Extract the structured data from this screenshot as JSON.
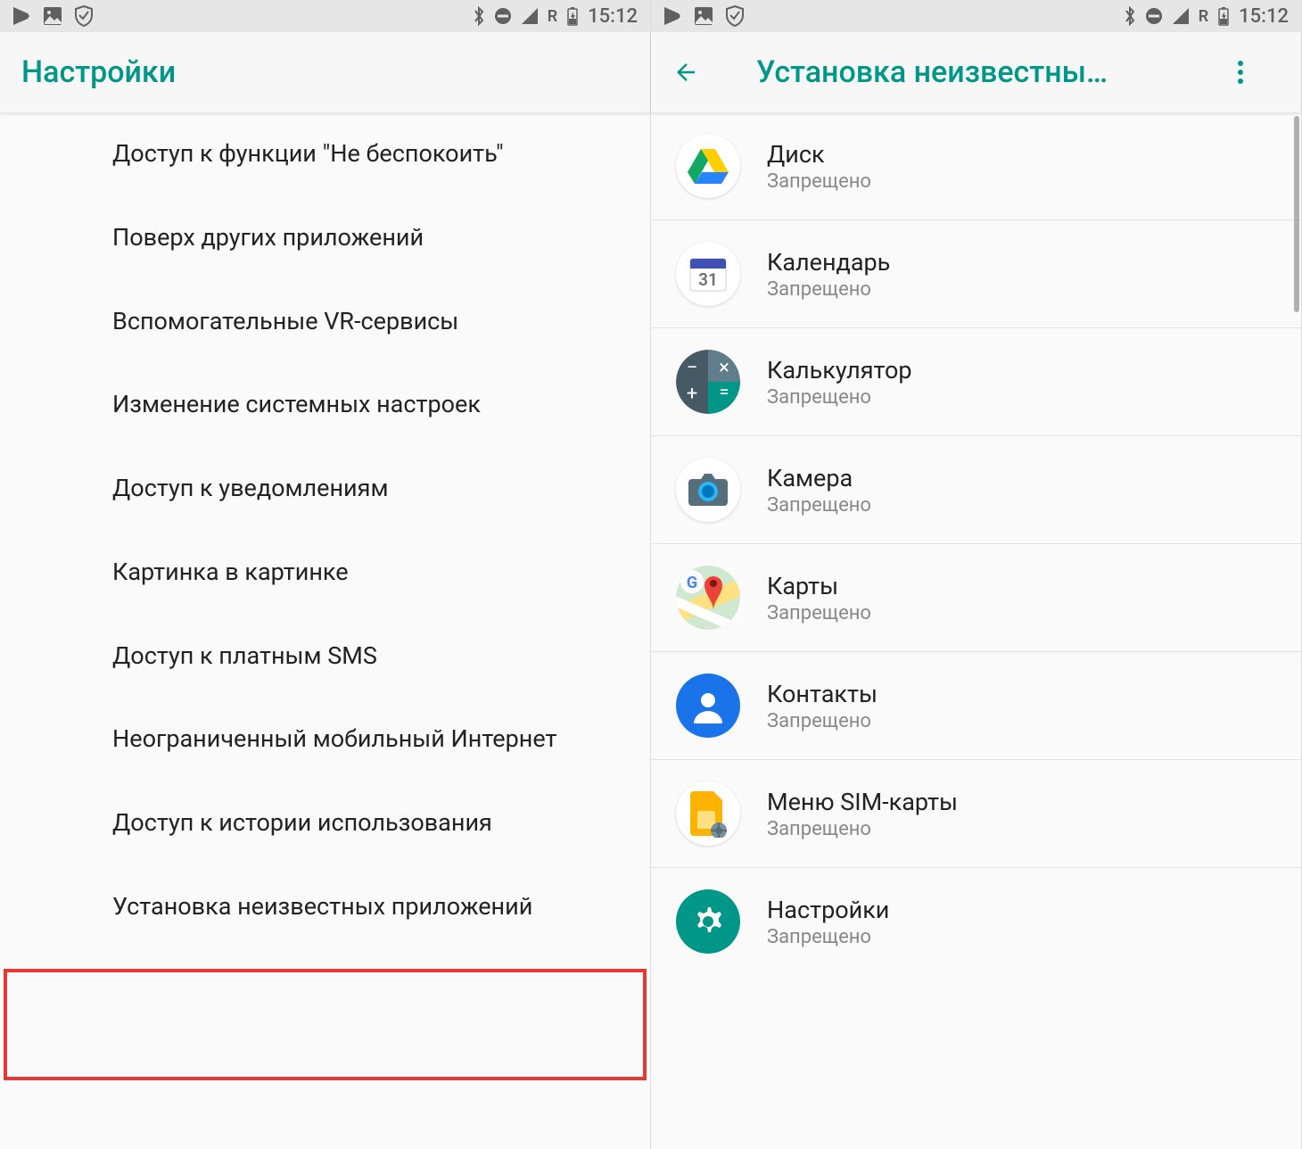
{
  "status": {
    "network_label": "R",
    "time": "15:12"
  },
  "left": {
    "title": "Настройки",
    "items": [
      "Доступ к функции \"Не беспокоить\"",
      "Поверх других приложений",
      "Вспомогательные VR-сервисы",
      "Изменение системных настроек",
      "Доступ к уведомлениям",
      "Картинка в картинке",
      "Доступ к платным SMS",
      "Неограниченный мобильный Интернет",
      "Доступ к истории использования",
      "Установка неизвестных приложений"
    ]
  },
  "right": {
    "title": "Установка неизвестны…",
    "apps": [
      {
        "name": "Диск",
        "status": "Запрещено",
        "icon": "drive"
      },
      {
        "name": "Календарь",
        "status": "Запрещено",
        "icon": "calendar",
        "calendar_day": "31"
      },
      {
        "name": "Калькулятор",
        "status": "Запрещено",
        "icon": "calculator"
      },
      {
        "name": "Камера",
        "status": "Запрещено",
        "icon": "camera"
      },
      {
        "name": "Карты",
        "status": "Запрещено",
        "icon": "maps"
      },
      {
        "name": "Контакты",
        "status": "Запрещено",
        "icon": "contacts"
      },
      {
        "name": "Меню SIM-карты",
        "status": "Запрещено",
        "icon": "sim"
      },
      {
        "name": "Настройки",
        "status": "Запрещено",
        "icon": "settings"
      }
    ]
  }
}
